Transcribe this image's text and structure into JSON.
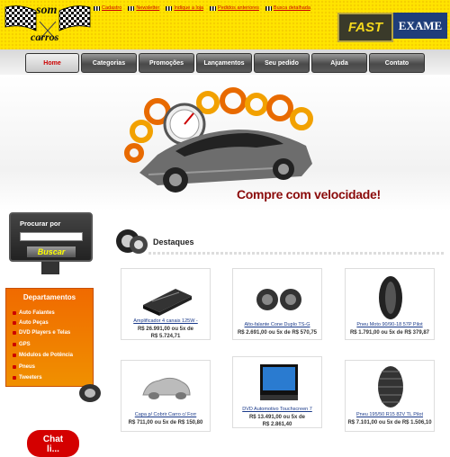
{
  "header": {
    "logo_top": "som",
    "logo_bottom": "carros",
    "links": [
      "Cadastro",
      "Newsletter",
      "Indique a loja",
      "Pedidos anteriores",
      "Busca detalhada"
    ],
    "partners": [
      "FAST",
      "EXAME"
    ]
  },
  "nav": [
    "Home",
    "Categorias",
    "Promoções",
    "Lançamentos",
    "Seu pedido",
    "Ajuda",
    "Contato"
  ],
  "banner": {
    "slogan": "Compre com velocidade!"
  },
  "search": {
    "label": "Procurar por",
    "value": "",
    "button": "Buscar"
  },
  "departments": {
    "title": "Departamentos",
    "items": [
      "Auto Falantes",
      "Auto Peças",
      "DVD Players e Telas",
      "GPS",
      "Módulos de Potência",
      "Pneus",
      "Tweeters"
    ]
  },
  "chat": {
    "line1": "Chat",
    "line2": "li..."
  },
  "featured": {
    "title": "Destaques",
    "products": [
      {
        "name": "Amplificador 4 canais 125W -",
        "price1": "R$ 26.991,00 ou 5x de",
        "price2": "R$ 5.724,71",
        "icon": "amplifier-icon"
      },
      {
        "name": "Alto-falante Cone Duplo TS-G",
        "price1": "R$ 2.691,00 ou 5x de R$ 570,75",
        "price2": "",
        "icon": "speaker-icon"
      },
      {
        "name": "Pneu Moto 90/90-18 57P Pilot",
        "price1": "R$ 1.791,00 ou 5x de R$ 379,87",
        "price2": "",
        "icon": "moto-tire-icon"
      },
      {
        "name": "Capa p/ Cobrir Carro c/ Forr",
        "price1": "R$ 711,00 ou 5x de R$ 150,80",
        "price2": "",
        "icon": "car-cover-icon"
      },
      {
        "name": "DVD Automotivo Touchscreen 7",
        "price1": "R$ 13.491,00 ou 5x de",
        "price2": "R$ 2.861,40",
        "icon": "dvd-player-icon"
      },
      {
        "name": "Pneu 195/50 R15 82V TL Pilot",
        "price1": "R$ 7.101,00 ou 5x de R$ 1.506,10",
        "price2": "",
        "icon": "car-tire-icon"
      }
    ]
  }
}
